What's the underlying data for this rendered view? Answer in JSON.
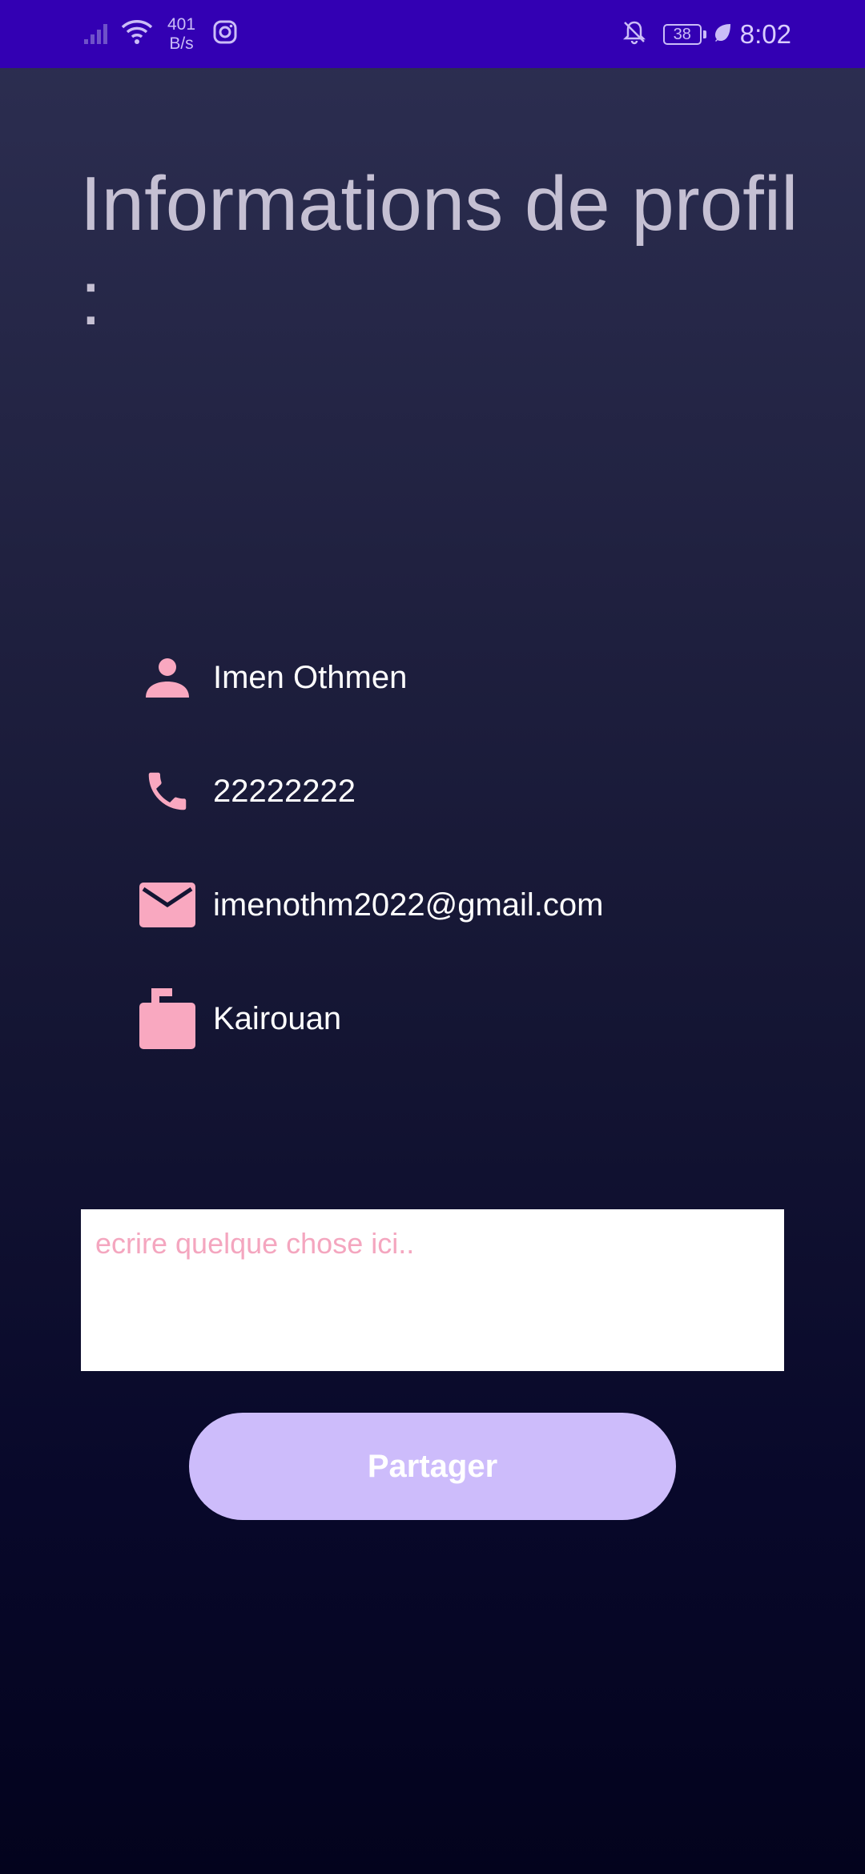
{
  "status_bar": {
    "net_speed_value": "401",
    "net_speed_unit": "B/s",
    "battery": "38",
    "time": "8:02",
    "icons": [
      "signal-icon",
      "wifi-icon",
      "instagram-icon",
      "bell-off-icon",
      "battery-icon",
      "leaf-icon"
    ]
  },
  "title": "Informations de profil :",
  "profile": {
    "name": "Imen Othmen",
    "phone": "22222222",
    "email": "imenothm2022@gmail.com",
    "city": "Kairouan",
    "icon_color": "#f9a8c0"
  },
  "compose": {
    "placeholder": "ecrire quelque chose ici.."
  },
  "share_button": {
    "label": "Partager",
    "color": "#cdbcfb"
  }
}
